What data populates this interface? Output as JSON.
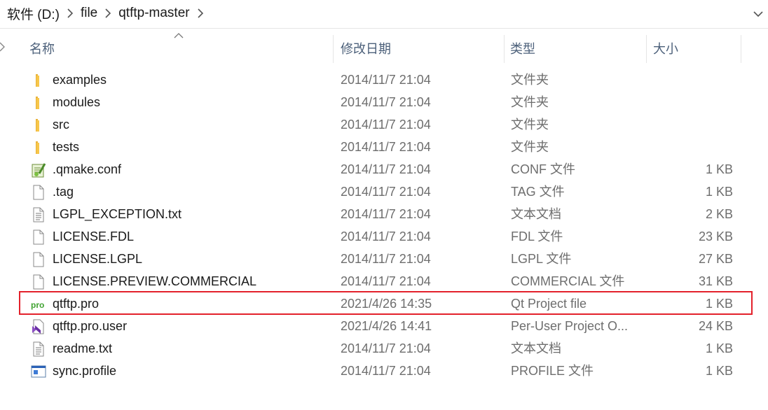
{
  "breadcrumb": [
    "软件 (D:)",
    "file",
    "qtftp-master"
  ],
  "columns": {
    "name": "名称",
    "date": "修改日期",
    "type": "类型",
    "size": "大小"
  },
  "files": [
    {
      "name": "examples",
      "date": "2014/11/7 21:04",
      "type": "文件夹",
      "size": "",
      "icon": "folder-icon"
    },
    {
      "name": "modules",
      "date": "2014/11/7 21:04",
      "type": "文件夹",
      "size": "",
      "icon": "folder-icon"
    },
    {
      "name": "src",
      "date": "2014/11/7 21:04",
      "type": "文件夹",
      "size": "",
      "icon": "folder-icon"
    },
    {
      "name": "tests",
      "date": "2014/11/7 21:04",
      "type": "文件夹",
      "size": "",
      "icon": "folder-icon"
    },
    {
      "name": ".qmake.conf",
      "date": "2014/11/7 21:04",
      "type": "CONF 文件",
      "size": "1 KB",
      "icon": "notepad-plus-plus-file-icon"
    },
    {
      "name": ".tag",
      "date": "2014/11/7 21:04",
      "type": "TAG 文件",
      "size": "1 KB",
      "icon": "blank-file-icon"
    },
    {
      "name": "LGPL_EXCEPTION.txt",
      "date": "2014/11/7 21:04",
      "type": "文本文档",
      "size": "2 KB",
      "icon": "text-file-icon"
    },
    {
      "name": "LICENSE.FDL",
      "date": "2014/11/7 21:04",
      "type": "FDL 文件",
      "size": "23 KB",
      "icon": "blank-file-icon"
    },
    {
      "name": "LICENSE.LGPL",
      "date": "2014/11/7 21:04",
      "type": "LGPL 文件",
      "size": "27 KB",
      "icon": "blank-file-icon"
    },
    {
      "name": "LICENSE.PREVIEW.COMMERCIAL",
      "date": "2014/11/7 21:04",
      "type": "COMMERCIAL 文件",
      "size": "31 KB",
      "icon": "blank-file-icon"
    },
    {
      "name": "qtftp.pro",
      "date": "2021/4/26 14:35",
      "type": "Qt Project file",
      "size": "1 KB",
      "icon": "qt-pro-file-icon",
      "highlighted": true
    },
    {
      "name": "qtftp.pro.user",
      "date": "2021/4/26 14:41",
      "type": "Per-User Project O...",
      "size": "24 KB",
      "icon": "visual-studio-file-icon"
    },
    {
      "name": "readme.txt",
      "date": "2014/11/7 21:04",
      "type": "文本文档",
      "size": "1 KB",
      "icon": "text-file-icon"
    },
    {
      "name": "sync.profile",
      "date": "2014/11/7 21:04",
      "type": "PROFILE 文件",
      "size": "1 KB",
      "icon": "profile-file-icon"
    }
  ],
  "colors": {
    "highlight_border": "#e3212b",
    "header_text": "#4c607a",
    "folder": "#f7c64a"
  }
}
